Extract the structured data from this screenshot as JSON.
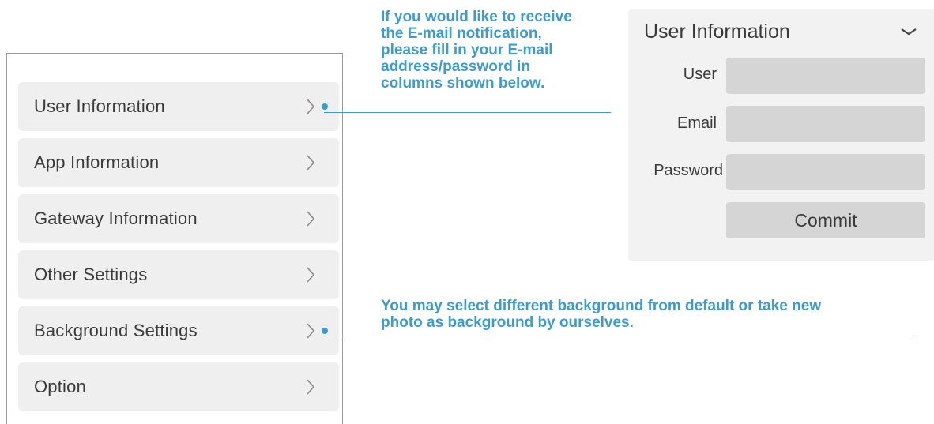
{
  "menu": {
    "items": [
      {
        "label": "User Information",
        "marked": true
      },
      {
        "label": "App Information",
        "marked": false
      },
      {
        "label": "Gateway Information",
        "marked": false
      },
      {
        "label": "Other Settings",
        "marked": false
      },
      {
        "label": "Background Settings",
        "marked": true
      },
      {
        "label": "Option",
        "marked": false
      }
    ]
  },
  "callouts": {
    "user_info_lines": [
      "If you would like to receive",
      "the E-mail notification,",
      "please fill in your E-mail",
      "address/password in",
      "columns shown below."
    ],
    "background_lines": [
      "You may select different background from default or take new",
      "photo as background by ourselves."
    ]
  },
  "card": {
    "title": "User Information",
    "fields": {
      "user_label": "User",
      "user_value": "",
      "email_label": "Email",
      "email_value": "",
      "password_label": "Password",
      "password_value": ""
    },
    "commit_label": "Commit"
  },
  "colors": {
    "accent": "#3b9cd0",
    "menu_item_bg": "#efefef",
    "input_bg": "#d5d5d5",
    "card_bg": "#f2f2f2"
  },
  "icons": {
    "menu_chevron": "chevron-right-icon",
    "card_chevron": "chevron-down-icon"
  }
}
